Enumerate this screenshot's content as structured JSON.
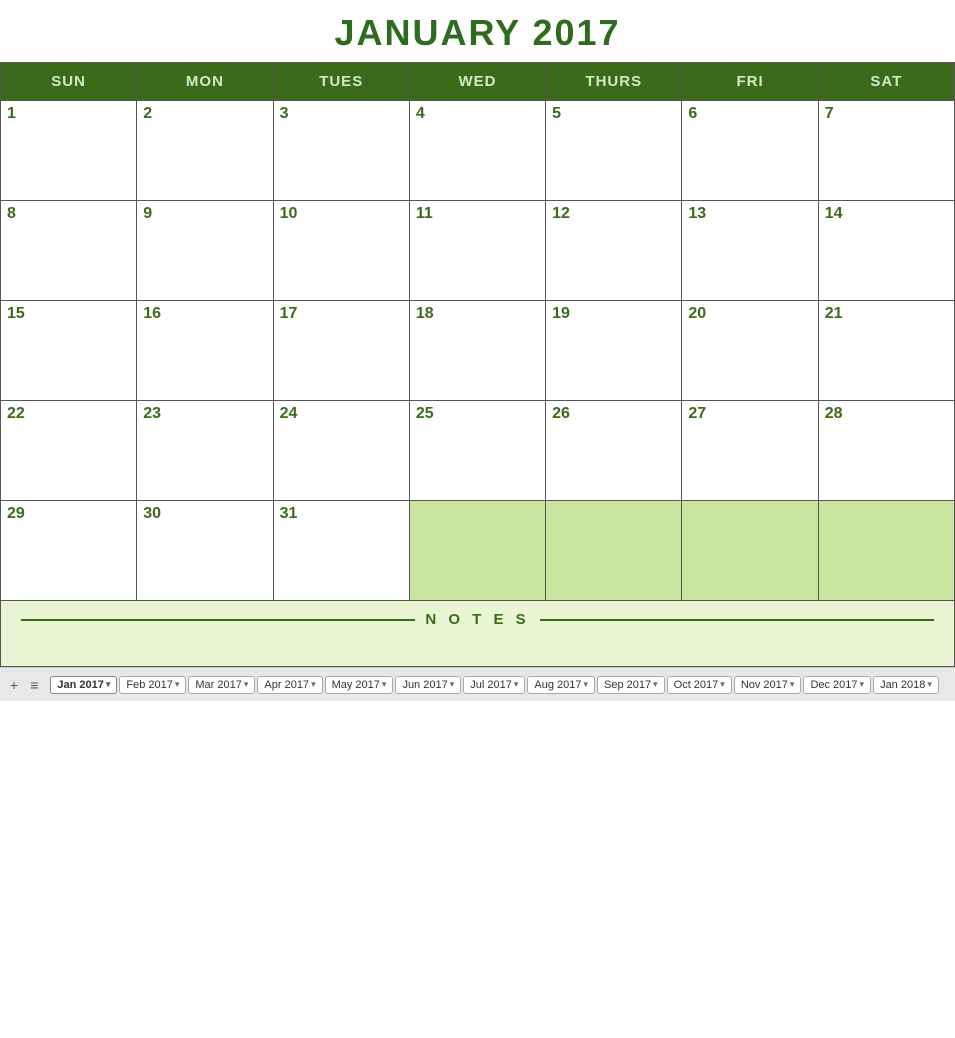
{
  "title": "JANUARY 2017",
  "colors": {
    "header_bg": "#3a6b1a",
    "header_text": "#d4e8c2",
    "day_number": "#3a6b1a",
    "title": "#2e6b1e",
    "notes_bg": "#eaf5d3",
    "empty_cell_bg": "#c8e6a0"
  },
  "weekdays": [
    "SUN",
    "MON",
    "TUES",
    "WED",
    "THURS",
    "FRI",
    "SAT"
  ],
  "weeks": [
    [
      {
        "day": "1",
        "empty": false
      },
      {
        "day": "2",
        "empty": false
      },
      {
        "day": "3",
        "empty": false
      },
      {
        "day": "4",
        "empty": false
      },
      {
        "day": "5",
        "empty": false
      },
      {
        "day": "6",
        "empty": false
      },
      {
        "day": "7",
        "empty": false
      }
    ],
    [
      {
        "day": "8",
        "empty": false
      },
      {
        "day": "9",
        "empty": false
      },
      {
        "day": "10",
        "empty": false
      },
      {
        "day": "11",
        "empty": false
      },
      {
        "day": "12",
        "empty": false
      },
      {
        "day": "13",
        "empty": false
      },
      {
        "day": "14",
        "empty": false
      }
    ],
    [
      {
        "day": "15",
        "empty": false
      },
      {
        "day": "16",
        "empty": false
      },
      {
        "day": "17",
        "empty": false
      },
      {
        "day": "18",
        "empty": false
      },
      {
        "day": "19",
        "empty": false
      },
      {
        "day": "20",
        "empty": false
      },
      {
        "day": "21",
        "empty": false
      }
    ],
    [
      {
        "day": "22",
        "empty": false
      },
      {
        "day": "23",
        "empty": false
      },
      {
        "day": "24",
        "empty": false
      },
      {
        "day": "25",
        "empty": false
      },
      {
        "day": "26",
        "empty": false
      },
      {
        "day": "27",
        "empty": false
      },
      {
        "day": "28",
        "empty": false
      }
    ],
    [
      {
        "day": "29",
        "empty": false
      },
      {
        "day": "30",
        "empty": false
      },
      {
        "day": "31",
        "empty": false
      },
      {
        "day": "",
        "empty": true
      },
      {
        "day": "",
        "empty": true
      },
      {
        "day": "",
        "empty": true
      },
      {
        "day": "",
        "empty": true
      }
    ]
  ],
  "notes_label": "N O T E S",
  "tabs": [
    {
      "label": "Jan 2017",
      "active": true
    },
    {
      "label": "Feb 2017",
      "active": false
    },
    {
      "label": "Mar 2017",
      "active": false
    },
    {
      "label": "Apr 2017",
      "active": false
    },
    {
      "label": "May 2017",
      "active": false
    },
    {
      "label": "Jun 2017",
      "active": false
    },
    {
      "label": "Jul 2017",
      "active": false
    },
    {
      "label": "Aug 2017",
      "active": false
    },
    {
      "label": "Sep 2017",
      "active": false
    },
    {
      "label": "Oct 2017",
      "active": false
    },
    {
      "label": "Nov 2017",
      "active": false
    },
    {
      "label": "Dec 2017",
      "active": false
    },
    {
      "label": "Jan 2018",
      "active": false
    }
  ],
  "tab_icons": [
    "+",
    "≡"
  ]
}
